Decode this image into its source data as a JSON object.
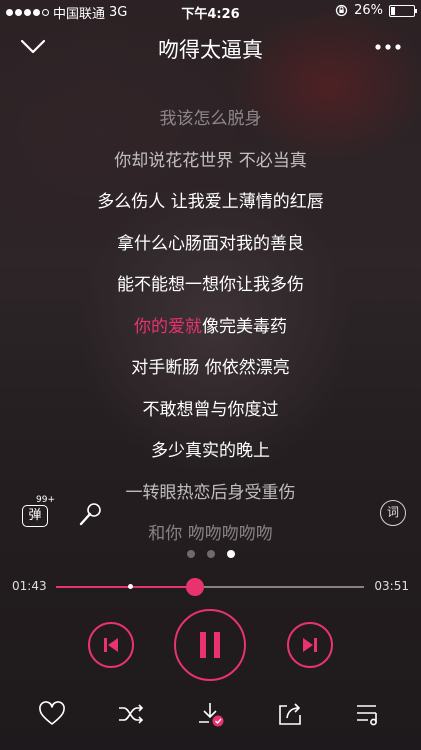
{
  "status_bar": {
    "carrier": "中国联通",
    "network": "3G",
    "time": "下午4:26",
    "battery": "26%",
    "battery_level": 0.26,
    "signal_bars_filled": 4,
    "signal_bars_total": 5
  },
  "header": {
    "title": "吻得太逼真",
    "back_icon": "chevron-down-icon",
    "more_icon": "more-dots-icon"
  },
  "lyrics": [
    {
      "text": "我该怎么脱身"
    },
    {
      "text": "你却说花花世界 不必当真"
    },
    {
      "text": "多么伤人 让我爱上薄情的红唇"
    },
    {
      "text": "拿什么心肠面对我的善良"
    },
    {
      "text": "能不能想一想你让我多伤"
    },
    {
      "text_highlighted": "你的爱就",
      "text_rest": "像完美毒药"
    },
    {
      "text": "对手断肠 你依然漂亮"
    },
    {
      "text": "不敢想曾与你度过"
    },
    {
      "text": "多少真实的晚上"
    },
    {
      "text": "一转眼热恋后身受重伤"
    },
    {
      "text": "和你 吻吻吻吻吻"
    }
  ],
  "side_tools": {
    "danmu_label": "弹",
    "danmu_count": "99+",
    "lyrics_label": "词"
  },
  "pager": {
    "pages": 3,
    "active": 3
  },
  "progress": {
    "current": "01:43",
    "total": "03:51",
    "played_fraction": 0.45,
    "buffered_fraction": 0.235
  },
  "colors": {
    "accent": "#e8336f"
  },
  "toolbar": {
    "icons": [
      "heart-icon",
      "shuffle-icon",
      "download-icon",
      "share-icon",
      "playlist-icon"
    ]
  }
}
